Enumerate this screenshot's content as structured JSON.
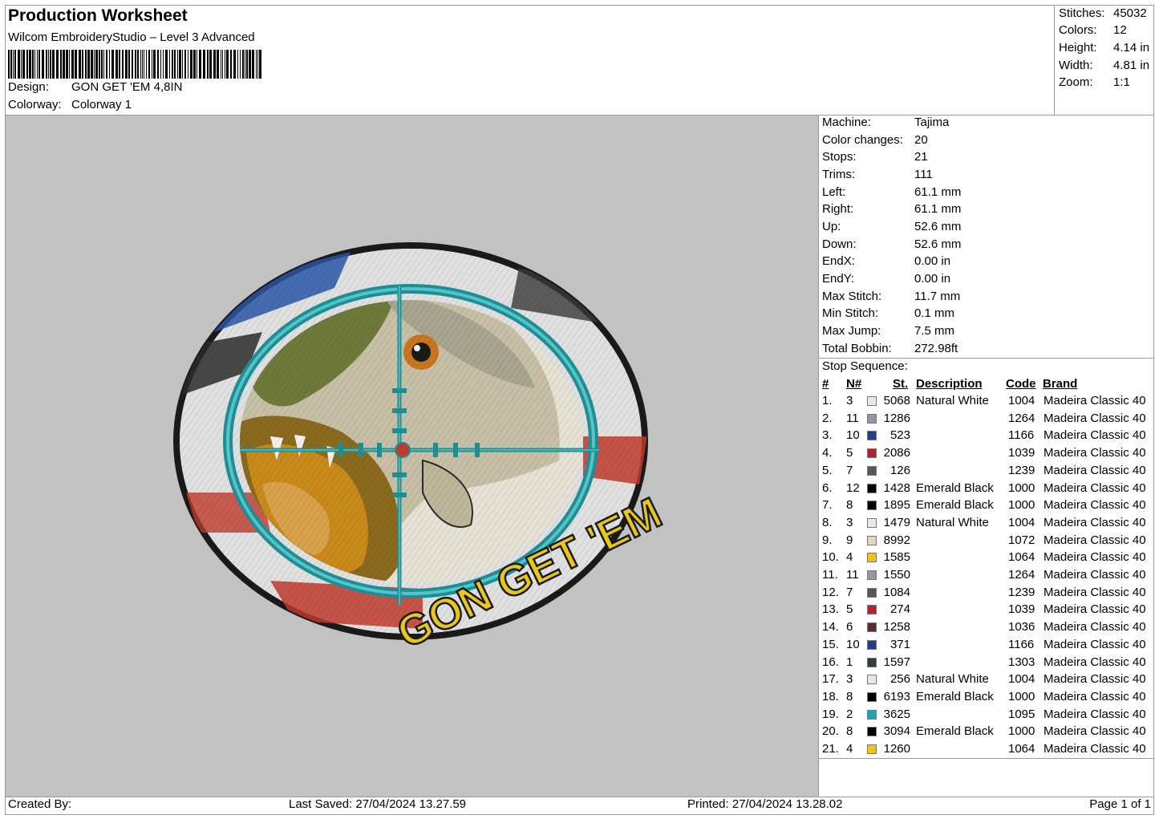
{
  "header": {
    "title": "Production Worksheet",
    "software": "Wilcom EmbroideryStudio – Level 3 Advanced",
    "design_label": "Design:",
    "design_value": "GON GET 'EM 4,8IN",
    "colorway_label": "Colorway:",
    "colorway_value": "Colorway 1"
  },
  "stats": [
    {
      "label": "Stitches:",
      "value": "45032"
    },
    {
      "label": "Colors:",
      "value": "12"
    },
    {
      "label": "Height:",
      "value": "4.14 in"
    },
    {
      "label": "Width:",
      "value": "4.81 in"
    },
    {
      "label": "Zoom:",
      "value": "1:1"
    }
  ],
  "design_text": "GON GET 'EM",
  "info": [
    {
      "label": "Machine:",
      "value": "Tajima"
    },
    {
      "label": "Color changes:",
      "value": "20"
    },
    {
      "label": "Stops:",
      "value": "21"
    },
    {
      "label": "Trims:",
      "value": "111"
    },
    {
      "label": "Left:",
      "value": "61.1 mm"
    },
    {
      "label": "Right:",
      "value": "61.1 mm"
    },
    {
      "label": "Up:",
      "value": "52.6 mm"
    },
    {
      "label": "Down:",
      "value": "52.6 mm"
    },
    {
      "label": "EndX:",
      "value": "0.00 in"
    },
    {
      "label": "EndY:",
      "value": "0.00 in"
    },
    {
      "label": "Max Stitch:",
      "value": "11.7 mm"
    },
    {
      "label": "Min Stitch:",
      "value": "0.1 mm"
    },
    {
      "label": "Max Jump:",
      "value": "7.5 mm"
    },
    {
      "label": "Total Bobbin:",
      "value": "272.98ft"
    }
  ],
  "stop_sequence_label": "Stop Sequence:",
  "columns": {
    "num": "#",
    "needle": "N#",
    "stitches": "St.",
    "description": "Description",
    "code": "Code",
    "brand": "Brand"
  },
  "sequence": [
    {
      "num": "1.",
      "needle": "3",
      "color": "#e8e8ec",
      "stitches": "5068",
      "description": "Natural White",
      "code": "1004",
      "brand": "Madeira Classic 40"
    },
    {
      "num": "2.",
      "needle": "11",
      "color": "#9a94a4",
      "stitches": "1286",
      "description": "",
      "code": "1264",
      "brand": "Madeira Classic 40"
    },
    {
      "num": "3.",
      "needle": "10",
      "color": "#1e3f8c",
      "stitches": "523",
      "description": "",
      "code": "1166",
      "brand": "Madeira Classic 40"
    },
    {
      "num": "4.",
      "needle": "5",
      "color": "#b3222e",
      "stitches": "2086",
      "description": "",
      "code": "1039",
      "brand": "Madeira Classic 40"
    },
    {
      "num": "5.",
      "needle": "7",
      "color": "#5a5656",
      "stitches": "126",
      "description": "",
      "code": "1239",
      "brand": "Madeira Classic 40"
    },
    {
      "num": "6.",
      "needle": "12",
      "color": "#000000",
      "stitches": "1428",
      "description": "Emerald Black",
      "code": "1000",
      "brand": "Madeira Classic 40"
    },
    {
      "num": "7.",
      "needle": "8",
      "color": "#000000",
      "stitches": "1895",
      "description": "Emerald Black",
      "code": "1000",
      "brand": "Madeira Classic 40"
    },
    {
      "num": "8.",
      "needle": "3",
      "color": "#e8e8ec",
      "stitches": "1479",
      "description": "Natural White",
      "code": "1004",
      "brand": "Madeira Classic 40"
    },
    {
      "num": "9.",
      "needle": "9",
      "color": "#e2d6bc",
      "stitches": "8992",
      "description": "",
      "code": "1072",
      "brand": "Madeira Classic 40"
    },
    {
      "num": "10.",
      "needle": "4",
      "color": "#f5c21c",
      "stitches": "1585",
      "description": "",
      "code": "1064",
      "brand": "Madeira Classic 40"
    },
    {
      "num": "11.",
      "needle": "11",
      "color": "#9a94a4",
      "stitches": "1550",
      "description": "",
      "code": "1264",
      "brand": "Madeira Classic 40"
    },
    {
      "num": "12.",
      "needle": "7",
      "color": "#5a5656",
      "stitches": "1084",
      "description": "",
      "code": "1239",
      "brand": "Madeira Classic 40"
    },
    {
      "num": "13.",
      "needle": "5",
      "color": "#b3222e",
      "stitches": "274",
      "description": "",
      "code": "1039",
      "brand": "Madeira Classic 40"
    },
    {
      "num": "14.",
      "needle": "6",
      "color": "#5c2c2c",
      "stitches": "1258",
      "description": "",
      "code": "1036",
      "brand": "Madeira Classic 40"
    },
    {
      "num": "15.",
      "needle": "10",
      "color": "#1e3f8c",
      "stitches": "371",
      "description": "",
      "code": "1166",
      "brand": "Madeira Classic 40"
    },
    {
      "num": "16.",
      "needle": "1",
      "color": "#354035",
      "stitches": "1597",
      "description": "",
      "code": "1303",
      "brand": "Madeira Classic 40"
    },
    {
      "num": "17.",
      "needle": "3",
      "color": "#e8e8ec",
      "stitches": "256",
      "description": "Natural White",
      "code": "1004",
      "brand": "Madeira Classic 40"
    },
    {
      "num": "18.",
      "needle": "8",
      "color": "#000000",
      "stitches": "6193",
      "description": "Emerald Black",
      "code": "1000",
      "brand": "Madeira Classic 40"
    },
    {
      "num": "19.",
      "needle": "2",
      "color": "#17a6b4",
      "stitches": "3625",
      "description": "",
      "code": "1095",
      "brand": "Madeira Classic 40"
    },
    {
      "num": "20.",
      "needle": "8",
      "color": "#000000",
      "stitches": "3094",
      "description": "Emerald Black",
      "code": "1000",
      "brand": "Madeira Classic 40"
    },
    {
      "num": "21.",
      "needle": "4",
      "color": "#f5c21c",
      "stitches": "1260",
      "description": "",
      "code": "1064",
      "brand": "Madeira Classic 40"
    }
  ],
  "footer": {
    "created_by": "Created By:",
    "last_saved": "Last Saved: 27/04/2024 13.27.59",
    "printed": "Printed: 27/04/2024 13.28.02",
    "page": "Page 1 of 1"
  }
}
